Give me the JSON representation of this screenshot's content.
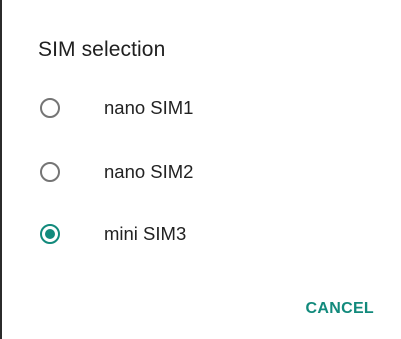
{
  "dialog": {
    "title": "SIM selection",
    "options": [
      {
        "label": "nano SIM1",
        "selected": false
      },
      {
        "label": "nano SIM2",
        "selected": false
      },
      {
        "label": "mini SIM3",
        "selected": true
      }
    ],
    "cancel_label": "CANCEL"
  },
  "colors": {
    "accent": "#128a7c",
    "radio_unchecked": "#757575",
    "text": "#222222"
  }
}
